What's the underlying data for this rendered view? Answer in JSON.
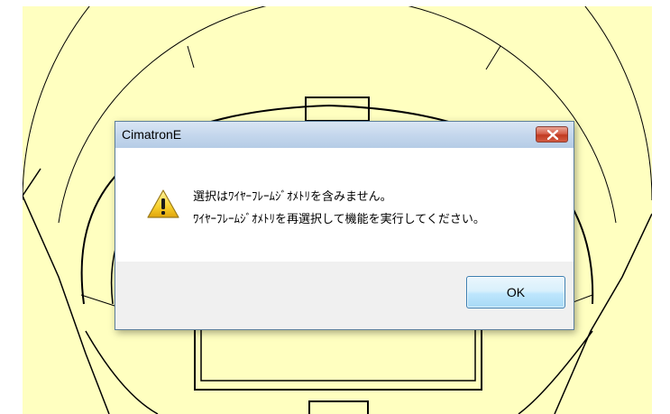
{
  "canvas": {
    "background_color": "#ffffc0",
    "line_color": "#000000"
  },
  "dialog": {
    "title": "CimatronE",
    "close_icon": "close-icon",
    "warning_icon": "warning-icon",
    "message_line_1": "選択はﾜｲﾔｰﾌﾚｰﾑｼﾞｵﾒﾄﾘを含みません。",
    "message_line_2": "ﾜｲﾔｰﾌﾚｰﾑｼﾞｵﾒﾄﾘを再選択して機能を実行してください。",
    "ok_label": "OK",
    "colors": {
      "titlebar": "#c3d6ec",
      "close_button": "#c13a21",
      "footer": "#f0f0f0",
      "ok_border": "#3c7fb1"
    }
  }
}
